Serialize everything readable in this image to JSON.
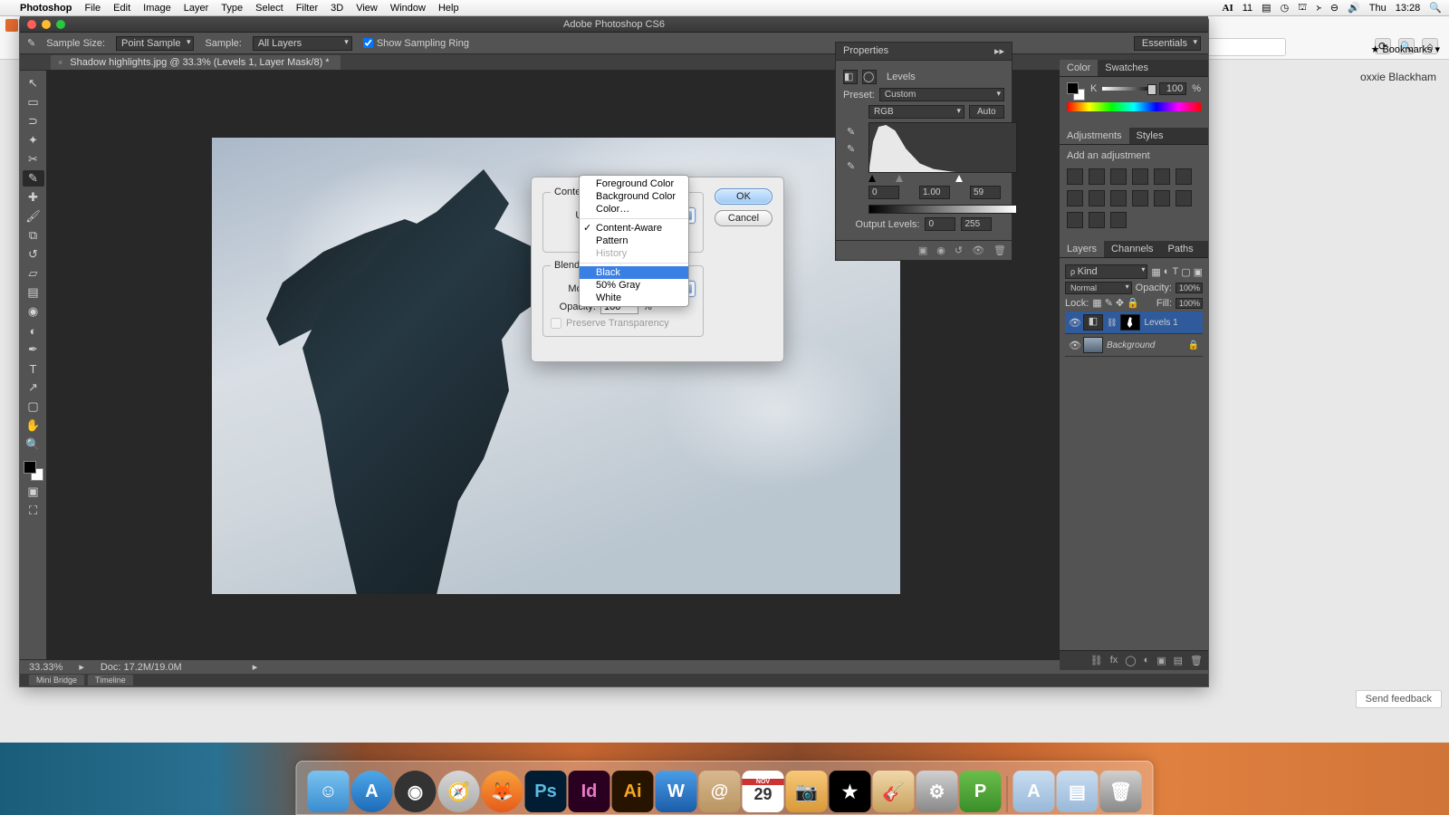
{
  "mac_menu": {
    "app": "Photoshop",
    "items": [
      "File",
      "Edit",
      "Image",
      "Layer",
      "Type",
      "Select",
      "Filter",
      "3D",
      "View",
      "Window",
      "Help"
    ],
    "right": {
      "ai": "11",
      "day": "Thu",
      "time": "13:28"
    }
  },
  "ps": {
    "title": "Adobe Photoshop CS6",
    "options": {
      "sample_size_label": "Sample Size:",
      "sample_size": "Point Sample",
      "sample_label": "Sample:",
      "sample": "All Layers",
      "show_sampling": "Show Sampling Ring",
      "workspace": "Essentials"
    },
    "doc_tab": "Shadow highlights.jpg @ 33.3% (Levels 1, Layer Mask/8) *",
    "status": {
      "zoom": "33.33%",
      "doc": "Doc: 17.2M/19.0M"
    },
    "bottom_tabs": [
      "Mini Bridge",
      "Timeline"
    ]
  },
  "fill_dialog": {
    "group1": "Contents",
    "use_label": "Use:",
    "use_value": "Content-Aware",
    "group2": "Blending",
    "mode_label": "Mode:",
    "opacity_label": "Opacity:",
    "opacity_value": "100",
    "opacity_unit": "%",
    "preserve": "Preserve Transparency",
    "ok": "OK",
    "cancel": "Cancel"
  },
  "fill_menu": {
    "items": [
      "Foreground Color",
      "Background Color",
      "Color…"
    ],
    "items2": [
      "Content-Aware",
      "Pattern",
      "History"
    ],
    "items3": [
      "Black",
      "50% Gray",
      "White"
    ],
    "checked": "Content-Aware",
    "selected": "Black",
    "disabled": "History"
  },
  "properties": {
    "title": "Properties",
    "adj_name": "Levels",
    "preset_label": "Preset:",
    "preset": "Custom",
    "channel": "RGB",
    "auto": "Auto",
    "levels": {
      "black": "0",
      "mid": "1.00",
      "white": "59"
    },
    "output_label": "Output Levels:",
    "output": {
      "low": "0",
      "high": "255"
    }
  },
  "panels": {
    "color_tabs": [
      "Color",
      "Swatches"
    ],
    "k_label": "K",
    "k_value": "100",
    "k_unit": "%",
    "adj_tabs": [
      "Adjustments",
      "Styles"
    ],
    "adj_hint": "Add an adjustment",
    "layers_tabs": [
      "Layers",
      "Channels",
      "Paths"
    ],
    "kind_label": "Kind",
    "blend": "Normal",
    "opacity_label": "Opacity:",
    "opacity": "100%",
    "lock_label": "Lock:",
    "fill_label": "Fill:",
    "fill": "100%",
    "layers": [
      {
        "name": "Levels 1",
        "italic": false,
        "locked": false
      },
      {
        "name": "Background",
        "italic": true,
        "locked": true
      }
    ]
  },
  "browser": {
    "bookmarks": "Bookmarks",
    "account": "oxxie Blackham",
    "feedback": "Send feedback"
  },
  "dock": {
    "date": "29",
    "apps": [
      "Finder",
      "App Store",
      "Dashboard",
      "Safari",
      "Firefox",
      "Photoshop",
      "InDesign",
      "Illustrator",
      "Word",
      "Contacts",
      "Calendar",
      "Photo Booth",
      "iMovie",
      "GarageBand",
      "System Preferences",
      "Publisher"
    ],
    "right": [
      "Applications",
      "Documents",
      "Trash"
    ]
  }
}
